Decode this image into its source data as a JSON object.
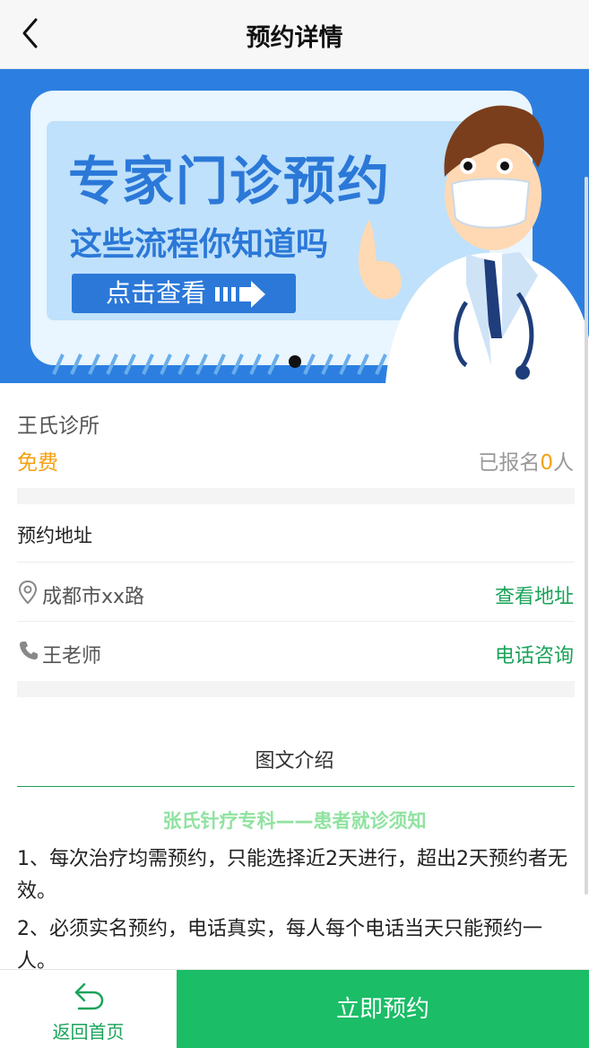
{
  "nav": {
    "title": "预约详情",
    "back_icon": "chevron-left-icon"
  },
  "banner": {
    "title": "专家门诊预约",
    "subtitle": "这些流程你知道吗",
    "button_label": "点击查看",
    "colors": {
      "background": "#2c7fe0",
      "panel": "#bfe1fb",
      "text": "#2b78d8"
    },
    "slide_count": 1,
    "active_slide": 1
  },
  "info": {
    "clinic_name": "王氏诊所",
    "price": "免费",
    "signup_prefix": "已报名",
    "signup_count": "0",
    "signup_suffix": "人"
  },
  "address": {
    "heading": "预约地址",
    "location_icon": "map-pin-icon",
    "location_text": "成都市xx路",
    "location_link": "查看地址",
    "phone_icon": "phone-icon",
    "contact_name": "王老师",
    "contact_link": "电话咨询"
  },
  "intro": {
    "tab_title": "图文介绍",
    "article_heading": "张氏针疗专科——患者就诊须知",
    "paragraphs": [
      "1、每次治疗均需预约，只能选择近2天进行，超出2天预约者无效。",
      "2、必须实名预约，电话真实，每人每个电话当天只能预约一人。"
    ]
  },
  "bottom": {
    "home_icon": "return-arrow-icon",
    "home_label": "返回首页",
    "book_label": "立即预约",
    "accent": "#1bbd67"
  }
}
